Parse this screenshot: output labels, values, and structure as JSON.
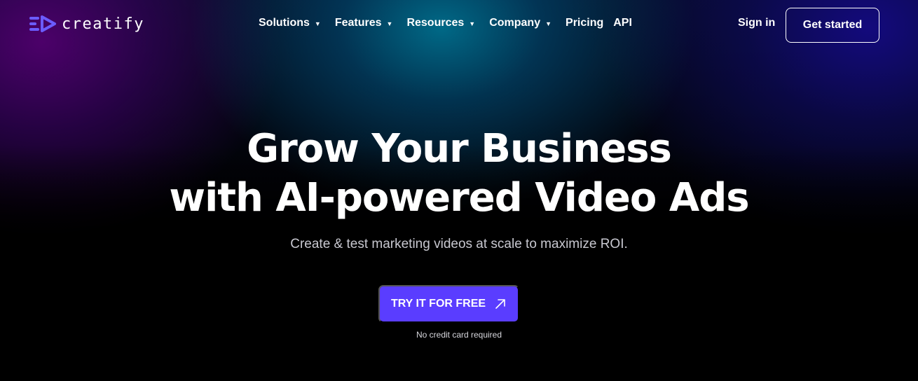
{
  "header": {
    "logo_text": "creatify",
    "nav": [
      {
        "label": "Solutions",
        "dropdown": true
      },
      {
        "label": "Features",
        "dropdown": true
      },
      {
        "label": "Resources",
        "dropdown": true
      },
      {
        "label": "Company",
        "dropdown": true
      },
      {
        "label": "Pricing",
        "dropdown": false
      },
      {
        "label": "API",
        "dropdown": false
      }
    ],
    "sign_in": "Sign in",
    "get_started": "Get started"
  },
  "hero": {
    "title_line1": "Grow Your Business",
    "title_line2": "with AI-powered Video Ads",
    "subtitle": "Create & test marketing videos at scale to maximize ROI.",
    "cta_label": "TRY IT FOR FREE",
    "cta_icon": "arrow-up-right-icon",
    "note": "No credit card required"
  },
  "colors": {
    "accent": "#5a3dff",
    "logo": "#6b5cff"
  }
}
